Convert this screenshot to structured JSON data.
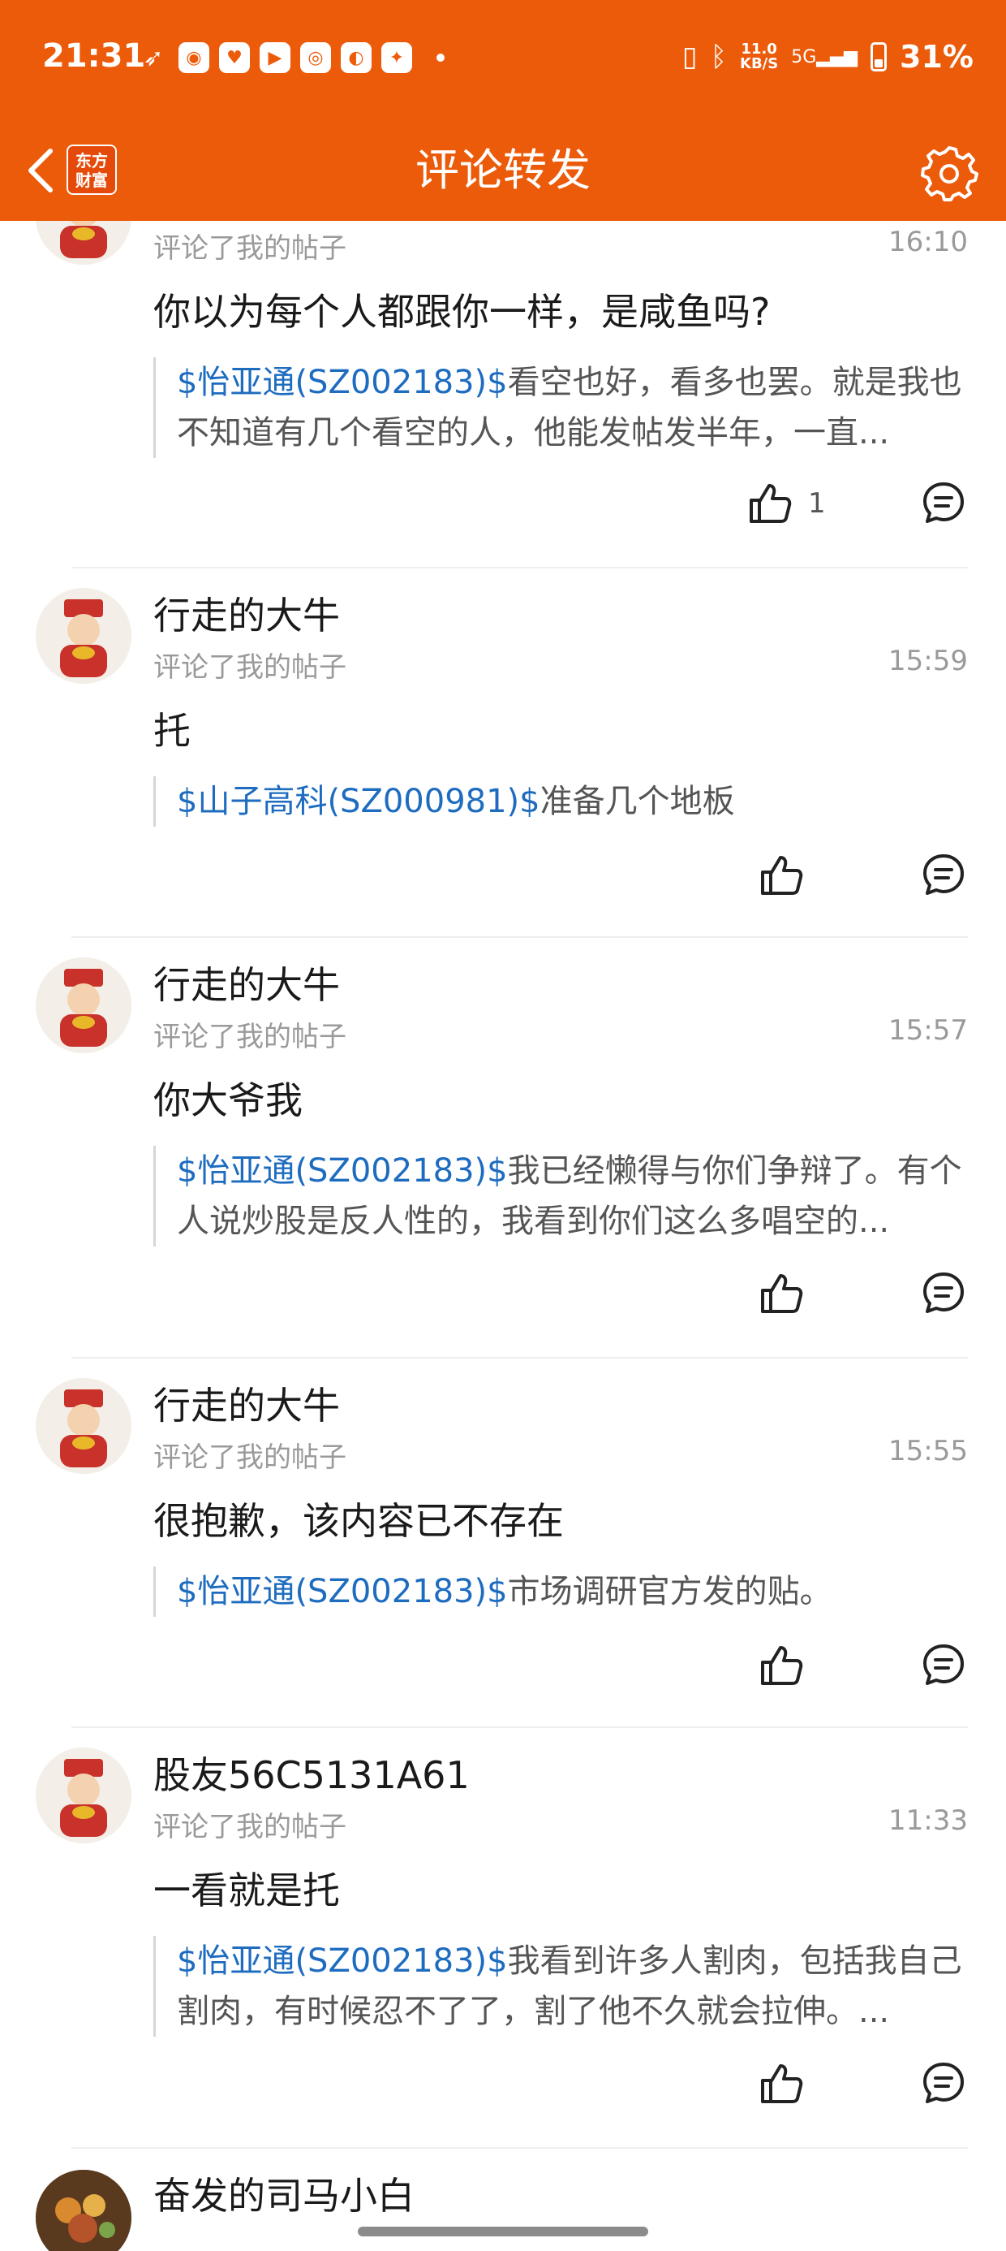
{
  "status_bar": {
    "time": "21:31",
    "net_speed_value": "11.0",
    "net_speed_unit": "KB/S",
    "signal_label": "5G",
    "battery": "31%"
  },
  "nav": {
    "title": "评论转发",
    "logo_line1": "东方",
    "logo_line2": "财富",
    "accent_color": "#ec5b0a"
  },
  "items": [
    {
      "name": "",
      "action": "评论了我的帖子",
      "time": "16:10",
      "comment": "你以为每个人都跟你一样，是咸鱼吗?",
      "quote_stock": "$怡亚通(SZ002183)$",
      "quote_text": "看空也好，看多也罢。就是我也不知道有几个看空的人，他能发帖发半年，一直...",
      "likes": "1"
    },
    {
      "name": "行走的大牛",
      "action": "评论了我的帖子",
      "time": "15:59",
      "comment": "托",
      "quote_stock": "$山子高科(SZ000981)$",
      "quote_text": "准备几个地板",
      "likes": ""
    },
    {
      "name": "行走的大牛",
      "action": "评论了我的帖子",
      "time": "15:57",
      "comment": "你大爷我",
      "quote_stock": "$怡亚通(SZ002183)$",
      "quote_text": "我已经懒得与你们争辩了。有个人说炒股是反人性的，我看到你们这么多唱空的...",
      "likes": ""
    },
    {
      "name": "行走的大牛",
      "action": "评论了我的帖子",
      "time": "15:55",
      "comment": " 很抱歉，该内容已不存在",
      "quote_stock": "$怡亚通(SZ002183)$",
      "quote_text": "市场调研官方发的贴。",
      "likes": ""
    },
    {
      "name": "股友56C5131A61",
      "action": "评论了我的帖子",
      "time": "11:33",
      "comment": "一看就是托",
      "quote_stock": "$怡亚通(SZ002183)$",
      "quote_text": "我看到许多人割肉，包括我自己割肉，有时候忍不了了，割了他不久就会拉伸。...",
      "likes": ""
    },
    {
      "name": "奋发的司马小白",
      "action": "",
      "time": "",
      "comment": "",
      "quote_stock": "",
      "quote_text": "",
      "likes": ""
    }
  ]
}
